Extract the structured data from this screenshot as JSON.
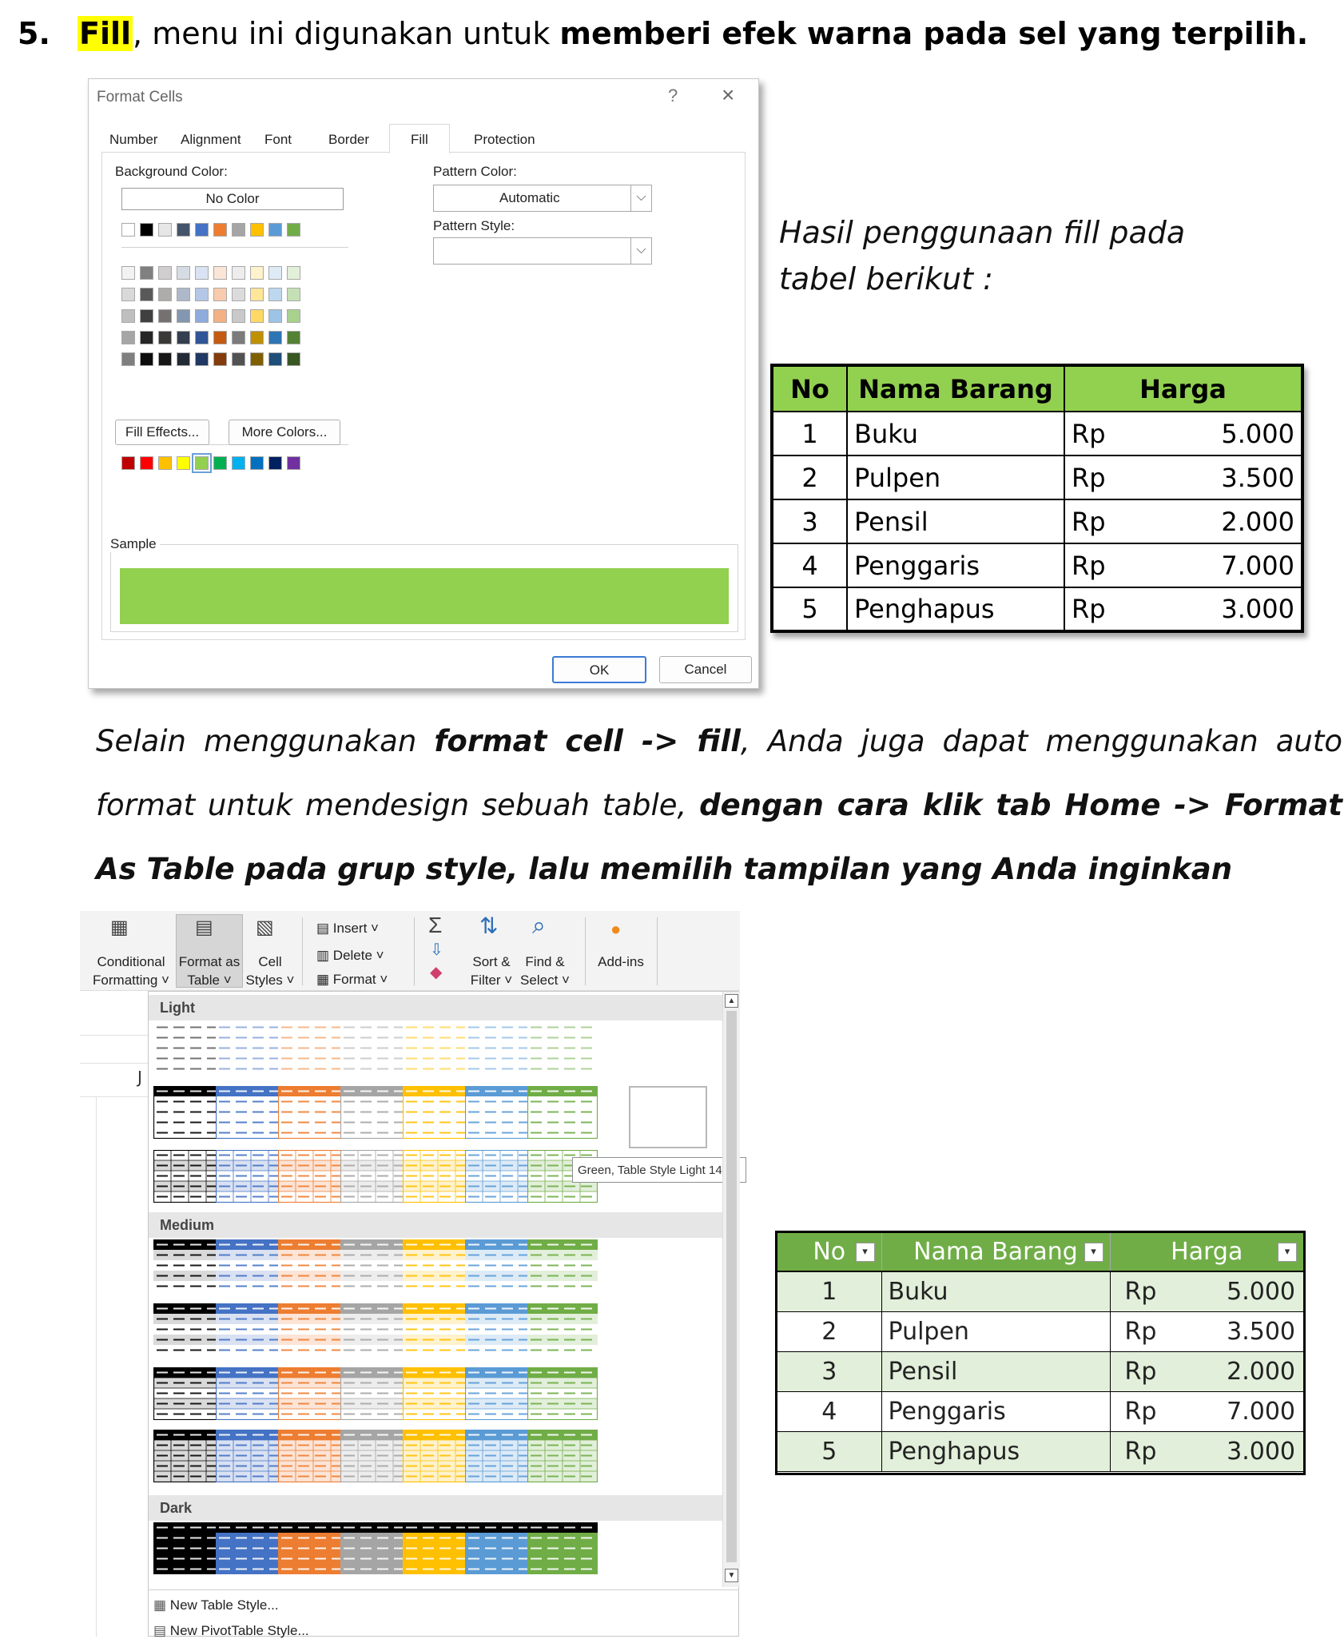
{
  "heading": {
    "number": "5.",
    "keyword": "Fill",
    "middle": ", menu ini digunakan untuk ",
    "bold_tail": "memberi efek warna pada sel yang terpilih."
  },
  "dialog": {
    "title": "Format Cells",
    "help": "?",
    "close": "×",
    "tabs": [
      "Number",
      "Alignment",
      "Font",
      "Border",
      "Fill",
      "Protection"
    ],
    "active_tab": "Fill",
    "background_color_label": "Background Color:",
    "no_color_button": "No Color",
    "pattern_color_label": "Pattern Color:",
    "pattern_color_value": "Automatic",
    "pattern_style_label": "Pattern Style:",
    "pattern_style_value": "",
    "fill_effects_button": "Fill Effects...",
    "more_colors_button": "More Colors...",
    "sample_label": "Sample",
    "sample_color": "#92d050",
    "ok_button": "OK",
    "cancel_button": "Cancel",
    "theme_top_row": [
      "#ffffff",
      "#000000",
      "#e7e6e6",
      "#44546a",
      "#4472c4",
      "#ed7d31",
      "#a5a5a5",
      "#ffc000",
      "#5b9bd5",
      "#70ad47"
    ],
    "theme_shades": [
      [
        "#f2f2f2",
        "#808080",
        "#d0cece",
        "#d6dce4",
        "#dae3f3",
        "#fbe5d6",
        "#ededed",
        "#fff2cc",
        "#deebf7",
        "#e2f0d9"
      ],
      [
        "#d9d9d9",
        "#595959",
        "#aeabab",
        "#adb9ca",
        "#b4c7e7",
        "#f8cbad",
        "#dbdbdb",
        "#ffe699",
        "#bdd7ee",
        "#c5e0b4"
      ],
      [
        "#bfbfbf",
        "#404040",
        "#767171",
        "#8497b0",
        "#8faadc",
        "#f4b183",
        "#c9c9c9",
        "#ffd966",
        "#9dc3e6",
        "#a9d18e"
      ],
      [
        "#a6a6a6",
        "#262626",
        "#3b3838",
        "#333f50",
        "#2f5597",
        "#c55a11",
        "#7b7b7b",
        "#bf9000",
        "#2e75b6",
        "#548235"
      ],
      [
        "#7f7f7f",
        "#0d0d0d",
        "#171717",
        "#222a35",
        "#203864",
        "#843c0c",
        "#525252",
        "#7f6000",
        "#1f4e79",
        "#385723"
      ]
    ],
    "standard_colors": [
      "#c00000",
      "#ff0000",
      "#ffc000",
      "#ffff00",
      "#92d050",
      "#00b050",
      "#00b0f0",
      "#0070c0",
      "#002060",
      "#7030a0"
    ]
  },
  "hasil_text": "Hasil penggunaan fill pada tabel berikut :",
  "table1": {
    "headers": [
      "No",
      "Nama Barang",
      "Harga"
    ],
    "rows": [
      [
        "1",
        "Buku",
        "Rp",
        "5.000"
      ],
      [
        "2",
        "Pulpen",
        "Rp",
        "3.500"
      ],
      [
        "3",
        "Pensil",
        "Rp",
        "2.000"
      ],
      [
        "4",
        "Penggaris",
        "Rp",
        "7.000"
      ],
      [
        "5",
        "Penghapus",
        "Rp",
        "3.000"
      ]
    ]
  },
  "paragraph": {
    "p1": "Selain menggunakan ",
    "b1": "format cell -> fill",
    "p2": ", Anda juga dapat menggunakan auto format untuk mendesign sebuah table, ",
    "b2": "dengan cara klik tab Home -> Format As Table pada grup style, lalu memilih tampilan yang Anda inginkan"
  },
  "ribbon": {
    "conditional_formatting": [
      "Conditional",
      "Formatting ˅"
    ],
    "format_as_table": [
      "Format as",
      "Table ˅"
    ],
    "cell_styles": [
      "Cell",
      "Styles ˅"
    ],
    "insert": "Insert ˅",
    "delete": "Delete ˅",
    "format": "Format ˅",
    "sort_filter": [
      "Sort &",
      "Filter ˅"
    ],
    "find_select": [
      "Find &",
      "Select ˅"
    ],
    "add_ins": "Add-ins"
  },
  "gallery": {
    "section_light": "Light",
    "section_medium": "Medium",
    "section_dark": "Dark",
    "tooltip": "Green, Table Style Light 14",
    "new_table_style": "New Table Style...",
    "new_pivot_style": "New PivotTable Style...",
    "sheet_col_letter": "J",
    "style_colors": [
      "#000000",
      "#4472c4",
      "#ed7d31",
      "#a5a5a5",
      "#ffc000",
      "#5b9bd5",
      "#70ad47"
    ],
    "style_tints": [
      "#d9d9d9",
      "#d9e1f2",
      "#fce4d6",
      "#ededed",
      "#fff2cc",
      "#ddebf7",
      "#e2efda"
    ]
  },
  "table2": {
    "headers": [
      "No",
      "Nama Barang",
      "Harga"
    ],
    "filter_icon": "▾",
    "rows": [
      [
        "1",
        "Buku",
        "Rp",
        "5.000"
      ],
      [
        "2",
        "Pulpen",
        "Rp",
        "3.500"
      ],
      [
        "3",
        "Pensil",
        "Rp",
        "2.000"
      ],
      [
        "4",
        "Penggaris",
        "Rp",
        "7.000"
      ],
      [
        "5",
        "Penghapus",
        "Rp",
        "3.000"
      ]
    ]
  }
}
